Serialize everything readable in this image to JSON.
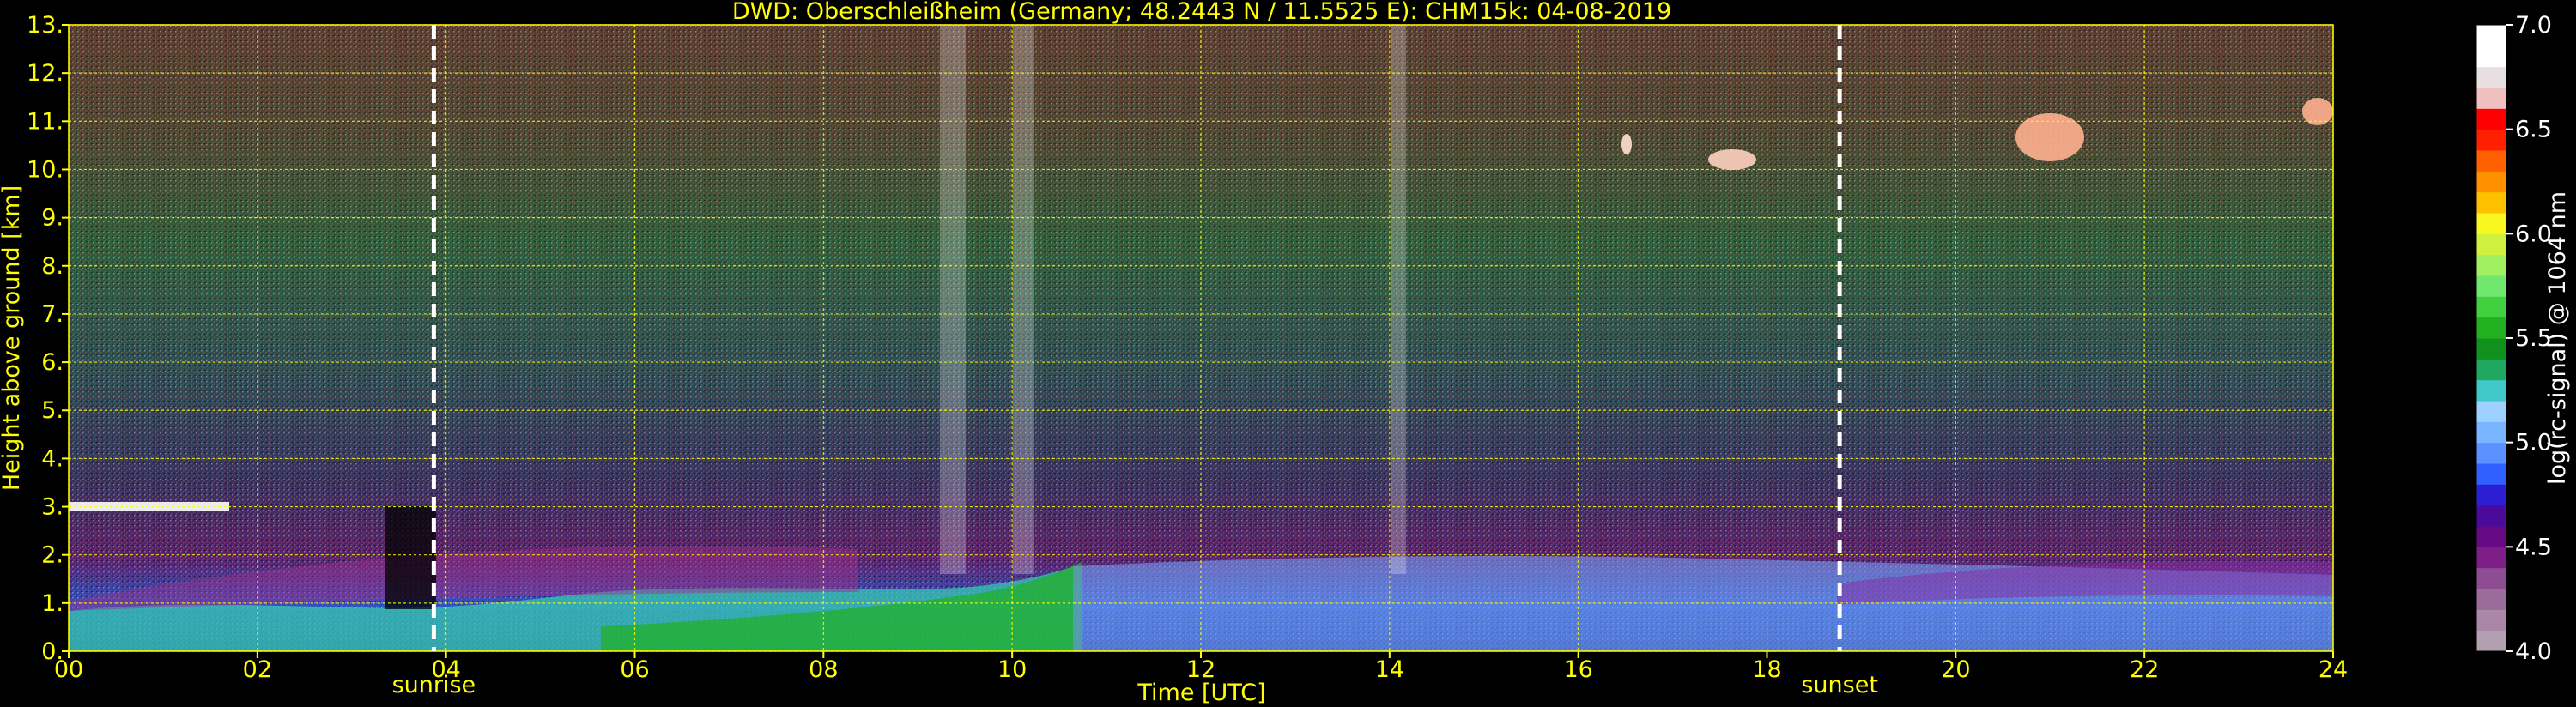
{
  "chart_data": [
    {
      "type": "heatmap",
      "title": "DWD: Oberschleißheim (Germany; 48.2443 N / 11.5525 E):    CHM15k: 04-08-2019",
      "xlabel": "Time [UTC]",
      "ylabel": "Height above ground [km]",
      "xlim": [
        0,
        24
      ],
      "ylim": [
        0,
        13
      ],
      "x_ticks": [
        "00",
        "02",
        "04",
        "06",
        "08",
        "10",
        "12",
        "14",
        "16",
        "18",
        "20",
        "22",
        "24"
      ],
      "y_ticks": [
        "0.",
        "1.",
        "2.",
        "3.",
        "4.",
        "5.",
        "6.",
        "7.",
        "8.",
        "9.",
        "10.",
        "11.",
        "12.",
        "13."
      ],
      "grid": true,
      "grid_color": "#ffff00",
      "text_color": "#ffff00",
      "background": "#000000",
      "markers": [
        {
          "label": "sunrise",
          "x": 3.87
        },
        {
          "label": "sunset",
          "x": 18.77
        }
      ],
      "colorbar": {
        "label": "log(rc-signal) @ 1064 nm",
        "range": [
          4.0,
          7.0
        ],
        "ticks": [
          "4.0",
          "4.5",
          "5.0",
          "5.5",
          "6.0",
          "6.5",
          "7.0"
        ],
        "levels": [
          "#b2a0b0",
          "#a888a6",
          "#9a6c9a",
          "#8e4c92",
          "#7e1f88",
          "#660a84",
          "#4a0a9a",
          "#2c1fd2",
          "#3060ff",
          "#5a90ff",
          "#78b4ff",
          "#9cd0ff",
          "#40c8c8",
          "#20a860",
          "#10901c",
          "#20b020",
          "#40d040",
          "#70e870",
          "#a0f060",
          "#d0f040",
          "#f8f820",
          "#ffc000",
          "#ff9000",
          "#ff6000",
          "#ff2000",
          "#ff0000",
          "#f0c0c0",
          "#e8e0e0",
          "#ffffff",
          "#ffffff"
        ]
      }
    }
  ]
}
